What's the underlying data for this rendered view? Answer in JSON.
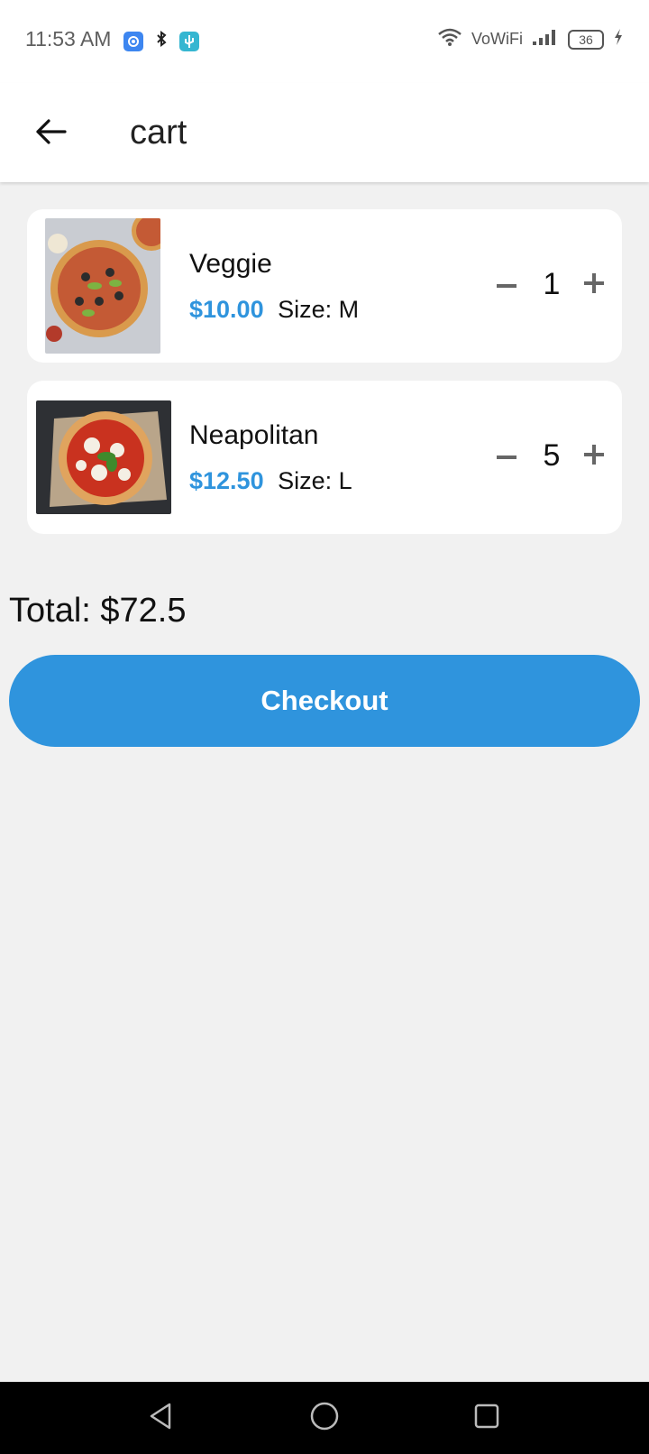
{
  "status_bar": {
    "time": "11:53 AM",
    "network": "VoWiFi",
    "battery": "36",
    "icons": [
      "settings-app-icon",
      "bluetooth-icon",
      "usb-icon",
      "wifi-icon",
      "signal-icon",
      "battery-icon",
      "charging-icon"
    ]
  },
  "app_bar": {
    "title": "cart",
    "back_icon": "arrow-left-icon"
  },
  "cart": {
    "items": [
      {
        "name": "Veggie",
        "price": "$10.00",
        "size": "Size: M",
        "quantity": "1",
        "image": "veggie-pizza-image"
      },
      {
        "name": "Neapolitan",
        "price": "$12.50",
        "size": "Size: L",
        "quantity": "5",
        "image": "neapolitan-pizza-image"
      }
    ],
    "total": "Total: $72.5"
  },
  "checkout_label": "Checkout",
  "colors": {
    "accent": "#2f94dd",
    "background": "#f1f1f1",
    "card": "#ffffff"
  },
  "nav_bar": {
    "icons": [
      "back-triangle-icon",
      "home-circle-icon",
      "recents-square-icon"
    ]
  }
}
